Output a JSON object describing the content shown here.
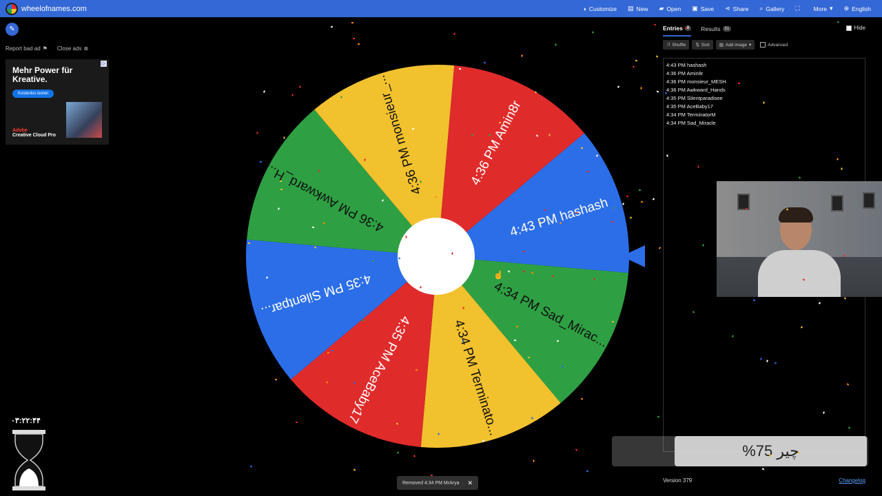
{
  "topbar": {
    "brand": "wheelofnames.com",
    "menu": [
      {
        "icon": "palette-icon",
        "glyph": "◑",
        "label": "Customize"
      },
      {
        "icon": "file-icon",
        "glyph": "▤",
        "label": "New"
      },
      {
        "icon": "folder-icon",
        "glyph": "▰",
        "label": "Open"
      },
      {
        "icon": "save-icon",
        "glyph": "▣",
        "label": "Save"
      },
      {
        "icon": "share-icon",
        "glyph": "⋖",
        "label": "Share"
      },
      {
        "icon": "search-icon",
        "glyph": "⌕",
        "label": "Gallery"
      },
      {
        "icon": "fullscreen-icon",
        "glyph": "⛶",
        "label": ""
      },
      {
        "icon": "chevron-down-icon",
        "glyph": "▾",
        "label": "More"
      },
      {
        "icon": "globe-icon",
        "glyph": "⊕",
        "label": "English"
      }
    ]
  },
  "ads": {
    "report": "Report bad ad",
    "close": "Close ads",
    "headline": "Mehr Power für Kreative.",
    "cta": "Kostenlos testen",
    "brand_small": "Adobe",
    "product": "Creative Cloud Pro"
  },
  "wheel": {
    "colors": [
      "#2c6ee8",
      "#2ea043",
      "#f2c12e",
      "#e02b2b"
    ],
    "segments": [
      {
        "label": "4:43 PM hashash",
        "color": "#2c6ee8"
      },
      {
        "label": "4:34 PM Sad_Mirac...",
        "color": "#2ea043"
      },
      {
        "label": "4:34 PM Terminato...",
        "color": "#f2c12e"
      },
      {
        "label": "4:35 PM AceBaby17",
        "color": "#e02b2b"
      },
      {
        "label": "4:35 PM Silentpar...",
        "color": "#2c6ee8"
      },
      {
        "label": "4:36 PM Awkward_H...",
        "color": "#2ea043"
      },
      {
        "label": "4:36 PM monsieur_...",
        "color": "#f2c12e"
      },
      {
        "label": "4:36 PM Amin8r",
        "color": "#e02b2b"
      }
    ],
    "pointer_color": "#2c6ee8"
  },
  "timer": "۰۳:۲۲:۴۴",
  "toast": {
    "message": "Removed 4:34 PM MrArya",
    "close": "✕"
  },
  "panel": {
    "tabs": [
      {
        "label": "Entries",
        "count": "8",
        "active": true
      },
      {
        "label": "Results",
        "count": "51",
        "active": false
      }
    ],
    "hide": "Hide",
    "toolbar": {
      "shuffle": "Shuffle",
      "sort": "Sort",
      "add_image": "Add image",
      "advanced": "Advanced"
    },
    "entries": [
      "4:43 PM hashash",
      "4:36 PM Amin8r",
      "4:36 PM monsieur_MESH",
      "4:36 PM Awkward_Hands",
      "4:35 PM Silentparadisee",
      "4:35 PM AceBaby17",
      "4:34 PM TerminatorM",
      "4:34 PM Sad_Miracle"
    ],
    "version": "Version 379",
    "changelog": "Changelog"
  },
  "overlay": {
    "progress_label": "چیر 75%",
    "progress_fraction": 0.75
  }
}
